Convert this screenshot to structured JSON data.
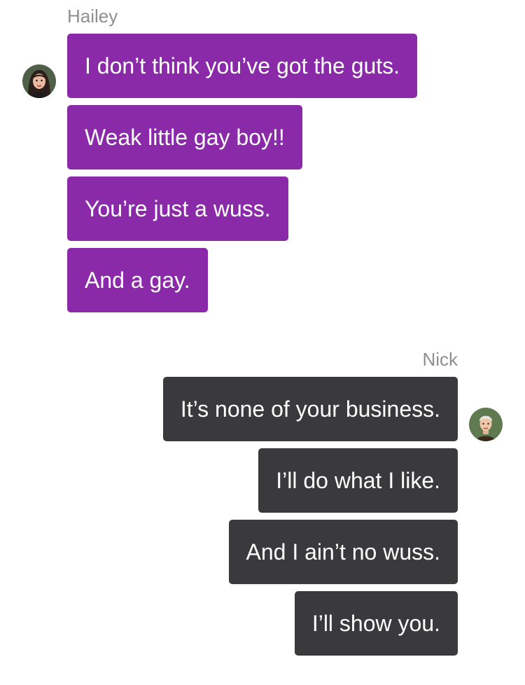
{
  "groups": [
    {
      "sender": "Hailey",
      "messages": [
        "I don’t think you’ve got the guts.",
        "Weak little gay boy!!",
        "You’re just a wuss.",
        "And a gay."
      ],
      "bubble_color": "#8a2aa9",
      "avatar_icon": "hailey-avatar-icon"
    },
    {
      "sender": "Nick",
      "messages": [
        "It’s none of your business.",
        "I’ll do what I like.",
        "And I ain’t no wuss.",
        "I’ll show you."
      ],
      "bubble_color": "#3a3a3c",
      "avatar_icon": "nick-avatar-icon"
    }
  ],
  "colors": {
    "name_text": "#8e8e93",
    "bubble_text": "#ffffff",
    "background": "#ffffff"
  }
}
